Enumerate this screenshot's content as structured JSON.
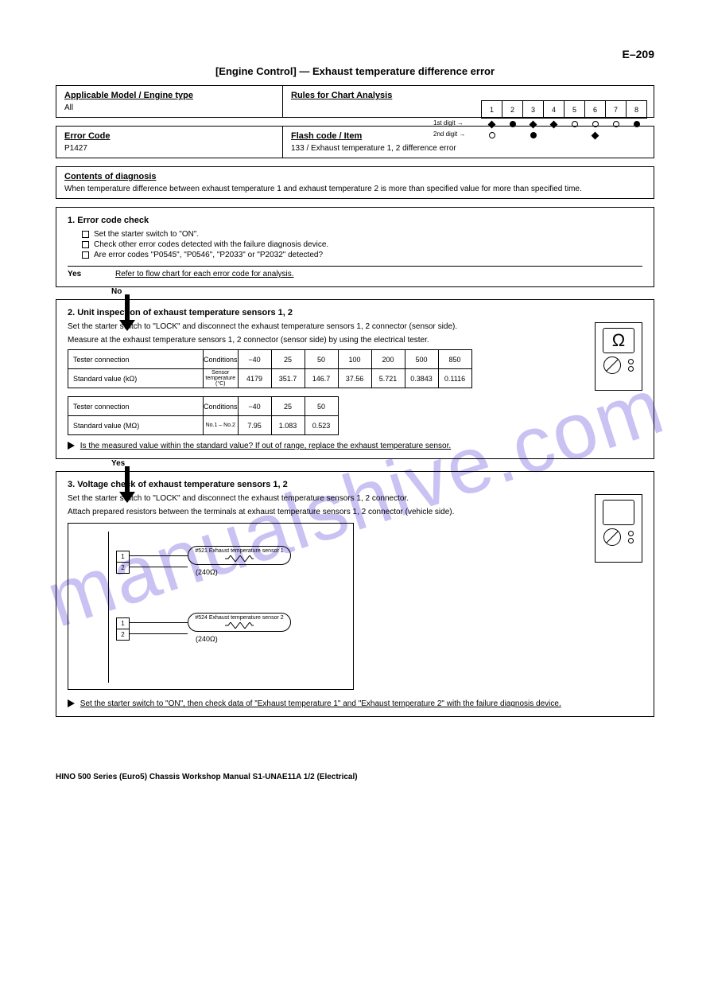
{
  "page_number": "E–209",
  "title": "[Engine Control] — Exhaust temperature difference error",
  "header": {
    "applicable_title": "Applicable Model / Engine type",
    "applicable_body": "All",
    "rules_title": "Rules for Chart Analysis",
    "rules_legend_left": "1st digit →",
    "rules_legend_right": "2nd digit →",
    "matrix_top": [
      "1",
      "2",
      "3",
      "4",
      "5",
      "6",
      "7",
      "8"
    ],
    "sym_top": [
      "diamond",
      "dot",
      "diamond",
      "diamond",
      "circ",
      "circ",
      "circ",
      "dot"
    ],
    "sym_bot": [
      "circ",
      "",
      "dot",
      "",
      "",
      "diamond",
      "",
      "",
      ""
    ]
  },
  "code": {
    "code_title": "Error Code",
    "code_val": "P1427",
    "item_title": "Flash code / Item",
    "item_val": "133 / Exhaust temperature 1, 2 difference error"
  },
  "contents": {
    "title": "Contents of diagnosis",
    "body": "When temperature difference between exhaust temperature 1 and exhaust temperature 2 is more than specified value for more than specified time."
  },
  "step1": {
    "title": "1. Error code check",
    "items": [
      "Set the starter switch to \"ON\".",
      "Check other error codes detected with the failure diagnosis device.",
      "Are error codes \"P0545\", \"P0546\", \"P2033\" or \"P2032\" detected?"
    ],
    "yes": "Yes",
    "yes_note": "Refer to flow chart for each error code for analysis.",
    "no": "No"
  },
  "step2": {
    "title": "2. Unit inspection of exhaust temperature sensors 1, 2",
    "p1": "Set the starter switch to \"LOCK\" and disconnect the exhaust temperature sensors 1, 2 connector (sensor side).",
    "p2": "Measure at the exhaust temperature sensors 1, 2 connector (sensor side) by using the electrical tester.",
    "t1_head": [
      "Tester connection",
      "Conditions",
      "−40",
      "25",
      "50",
      "100",
      "200",
      "500",
      "850"
    ],
    "t1_row_lbl": "Standard value (kΩ)",
    "t1_row": [
      "4179",
      "351.7",
      "146.7",
      "37.56",
      "5.721",
      "0.3843",
      "0.1116"
    ],
    "t2_head": [
      "Tester connection",
      "Conditions",
      "−40",
      "25",
      "50"
    ],
    "t2_row_lbl": "Standard value (MΩ)",
    "t2_row": [
      "7.95",
      "1.083",
      "0.523"
    ],
    "t1_conn": "No.1 – No.2",
    "t1_cond": "Sensor temperature (°C)",
    "after": "Is the measured value within the standard value? If out of range, replace the exhaust temperature sensor.",
    "yes": "Yes",
    "meter_sym": "Ω"
  },
  "step3": {
    "title": "3. Voltage check of exhaust temperature sensors 1, 2",
    "p1": "Set the starter switch to \"LOCK\" and disconnect the exhaust temperature sensors 1, 2 connector.",
    "p2": "Attach prepared resistors between the terminals at exhaust temperature sensors 1, 2 connector (vehicle side).",
    "term1a": "1",
    "term1b": "2",
    "res_val": "(240Ω)",
    "heater1": "#521 Exhaust temperature sensor 1",
    "heater2": "#524 Exhaust temperature sensor 2",
    "after": "Set the starter switch to \"ON\", then check data of \"Exhaust temperature 1\" and \"Exhaust temperature 2\" with the failure diagnosis device.",
    "meter_sym": ""
  },
  "footer": "HINO 500 Series (Euro5) Chassis Workshop Manual S1-UNAE11A 1/2 (Electrical)"
}
